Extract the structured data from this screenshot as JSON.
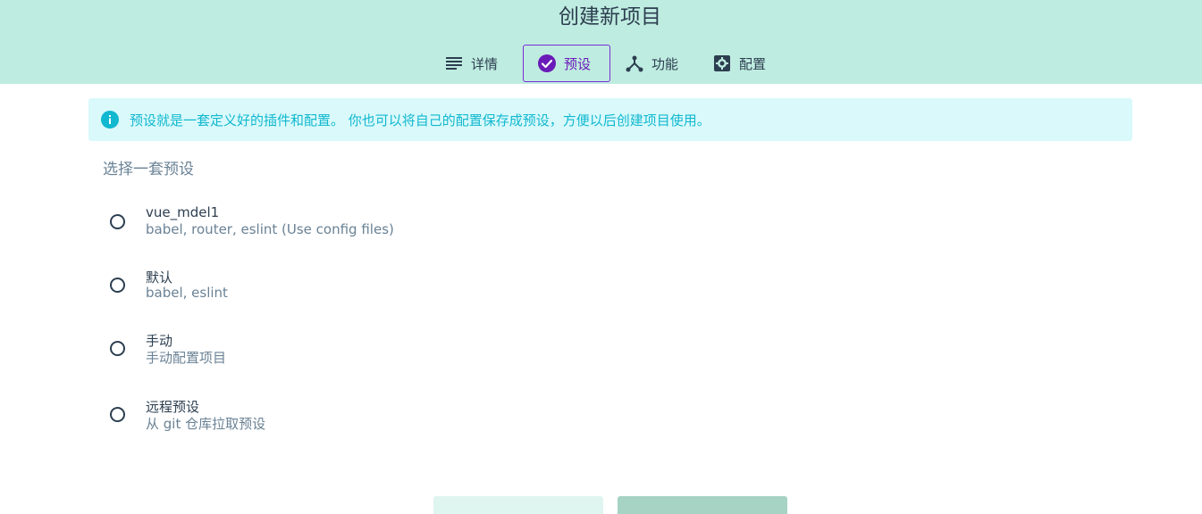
{
  "page": {
    "title": "创建新项目"
  },
  "tabs": [
    {
      "label": "详情",
      "icon": "subject-icon",
      "active": false
    },
    {
      "label": "预设",
      "icon": "check-circle-icon",
      "active": true
    },
    {
      "label": "功能",
      "icon": "call-split-icon",
      "active": false
    },
    {
      "label": "配置",
      "icon": "settings-icon",
      "active": false
    }
  ],
  "info": {
    "text": "预设就是一套定义好的插件和配置。 你也可以将自己的配置保存成预设，方便以后创建项目使用。",
    "icon": "info-icon"
  },
  "presets": {
    "label": "选择一套预设",
    "options": [
      {
        "name": "vue_mdel1",
        "description": "babel, router, eslint (Use config files)",
        "selected": false
      },
      {
        "name": "默认",
        "description": "babel, eslint",
        "selected": false
      },
      {
        "name": "手动",
        "description": "手动配置项目",
        "selected": false
      },
      {
        "name": "远程预设",
        "description": "从 git 仓库拉取预设",
        "selected": false
      }
    ]
  },
  "colors": {
    "header_bg": "#bfece0",
    "accent": "#7b2cd6",
    "info_bg": "#d9f9fb",
    "info_text": "#11b8cf"
  }
}
